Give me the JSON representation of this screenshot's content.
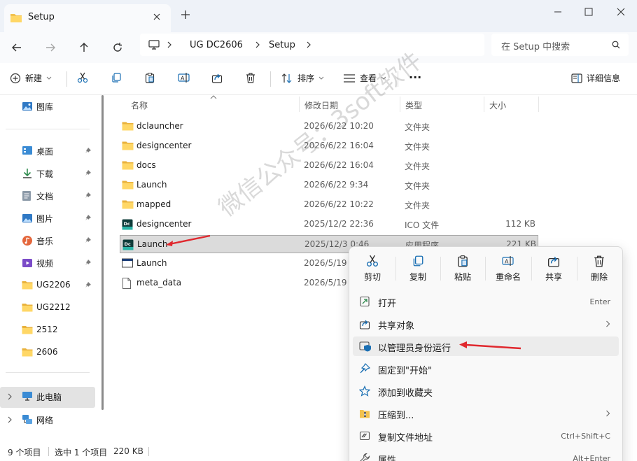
{
  "window": {
    "tab_title": "Setup",
    "new_tab": "+",
    "minimize": "—",
    "maximize": "☐",
    "close": "✕"
  },
  "address": {
    "crumbs": [
      "UG DC2606",
      "Setup"
    ],
    "search_placeholder": "在 Setup 中搜索"
  },
  "commandbar": {
    "new_label": "新建",
    "sort_label": "排序",
    "view_label": "查看",
    "more": "···",
    "details_label": "详细信息"
  },
  "sidebar": {
    "gallery": "图库",
    "items": [
      {
        "label": "桌面",
        "icon": "desktop-icon",
        "pinned": true
      },
      {
        "label": "下载",
        "icon": "download-icon",
        "pinned": true
      },
      {
        "label": "文档",
        "icon": "document-icon",
        "pinned": true
      },
      {
        "label": "图片",
        "icon": "picture-icon",
        "pinned": true
      },
      {
        "label": "音乐",
        "icon": "music-icon",
        "pinned": true
      },
      {
        "label": "视频",
        "icon": "video-icon",
        "pinned": true
      },
      {
        "label": "UG2206",
        "icon": "folder-icon",
        "pinned": true
      },
      {
        "label": "UG2212",
        "icon": "folder-icon",
        "pinned": false
      },
      {
        "label": "2512",
        "icon": "folder-icon",
        "pinned": false
      },
      {
        "label": "2606",
        "icon": "folder-icon",
        "pinned": false
      }
    ],
    "this_pc": "此电脑",
    "network": "网络"
  },
  "columns": {
    "name": "名称",
    "date": "修改日期",
    "type": "类型",
    "size": "大小"
  },
  "files": [
    {
      "name": "dclauncher",
      "date": "2026/6/22 10:20",
      "type": "文件夹",
      "size": "",
      "icon": "folder-icon"
    },
    {
      "name": "designcenter",
      "date": "2026/6/22 16:04",
      "type": "文件夹",
      "size": "",
      "icon": "folder-icon"
    },
    {
      "name": "docs",
      "date": "2026/6/22 16:04",
      "type": "文件夹",
      "size": "",
      "icon": "folder-icon"
    },
    {
      "name": "Launch",
      "date": "2026/6/22 9:34",
      "type": "文件夹",
      "size": "",
      "icon": "folder-icon"
    },
    {
      "name": "mapped",
      "date": "2026/6/22 10:22",
      "type": "文件夹",
      "size": "",
      "icon": "folder-icon"
    },
    {
      "name": "designcenter",
      "date": "2025/12/2 22:36",
      "type": "ICO 文件",
      "size": "112 KB",
      "icon": "dc-app-icon"
    },
    {
      "name": "Launch",
      "date": "2025/12/3 0:46",
      "type": "应用程序",
      "size": "221 KB",
      "icon": "dc-app-icon"
    },
    {
      "name": "Launch",
      "date": "2026/5/19",
      "type": "",
      "size": "",
      "icon": "window-file-icon"
    },
    {
      "name": "meta_data",
      "date": "2026/5/19",
      "type": "",
      "size": "",
      "icon": "blank-file-icon"
    }
  ],
  "status": {
    "count": "9 个项目",
    "selected": "选中 1 个项目",
    "size": "220 KB"
  },
  "context_menu": {
    "quick": [
      {
        "label": "剪切",
        "icon": "scissors-icon"
      },
      {
        "label": "复制",
        "icon": "copy-icon"
      },
      {
        "label": "粘贴",
        "icon": "paste-icon"
      },
      {
        "label": "重命名",
        "icon": "rename-icon"
      },
      {
        "label": "共享",
        "icon": "share-icon"
      },
      {
        "label": "删除",
        "icon": "trash-icon"
      }
    ],
    "items": [
      {
        "label": "打开",
        "shortcut": "Enter",
        "icon": "open-icon"
      },
      {
        "label": "共享对象",
        "shortcut": "",
        "icon": "share-with-icon",
        "submenu": true
      },
      {
        "label": "以管理员身份运行",
        "shortcut": "",
        "icon": "admin-shield-icon"
      },
      {
        "label": "固定到\"开始\"",
        "shortcut": "",
        "icon": "pin-start-icon"
      },
      {
        "label": "添加到收藏夹",
        "shortcut": "",
        "icon": "star-icon"
      },
      {
        "label": "压缩到...",
        "shortcut": "",
        "icon": "zip-icon",
        "submenu": true
      },
      {
        "label": "复制文件地址",
        "shortcut": "Ctrl+Shift+C",
        "icon": "copy-path-icon"
      },
      {
        "label": "属性",
        "shortcut": "Alt+Enter",
        "icon": "wrench-icon"
      }
    ]
  },
  "watermark": "微信公众号：3soft软件",
  "colors": {
    "accent": "#0067c0",
    "folder": "#f2c24f",
    "annotation_arrow": "#e0282e"
  }
}
